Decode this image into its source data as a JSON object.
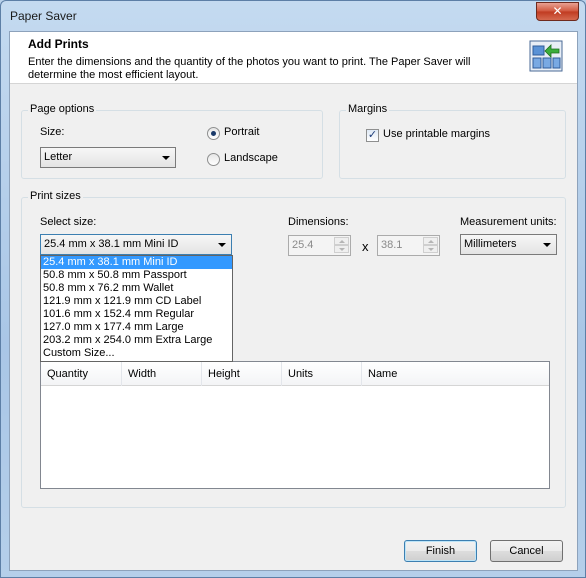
{
  "window": {
    "title": "Paper Saver",
    "close_label": "✕"
  },
  "header": {
    "title": "Add Prints",
    "description": "Enter the dimensions and the quantity of the photos you want to print. The Paper Saver will determine the most efficient layout.",
    "icon": "add-prints-icon"
  },
  "page_options": {
    "label": "Page options",
    "size_label": "Size:",
    "size_value": "Letter",
    "portrait_label": "Portrait",
    "landscape_label": "Landscape",
    "orientation": "Portrait"
  },
  "margins": {
    "label": "Margins",
    "use_printable_label": "Use printable margins",
    "use_printable_checked": true
  },
  "print_sizes": {
    "label": "Print sizes",
    "select_size_label": "Select size:",
    "selected_size": "25.4 mm x 38.1 mm Mini ID",
    "dimensions_label": "Dimensions:",
    "width_value": "25.4",
    "times_symbol": "x",
    "height_value": "38.1",
    "units_label": "Measurement units:",
    "units_value": "Millimeters",
    "size_options": [
      "25.4 mm x 38.1 mm Mini ID",
      "50.8 mm x 50.8 mm Passport",
      "50.8 mm x 76.2 mm Wallet",
      "121.9 mm x 121.9 mm CD Label",
      "101.6 mm x 152.4 mm Regular",
      "127.0 mm x 177.4 mm Large",
      "203.2 mm x 254.0 mm Extra Large",
      "Custom Size..."
    ],
    "columns": [
      "Quantity",
      "Width",
      "Height",
      "Units",
      "Name"
    ]
  },
  "buttons": {
    "finish": "Finish",
    "cancel": "Cancel"
  }
}
